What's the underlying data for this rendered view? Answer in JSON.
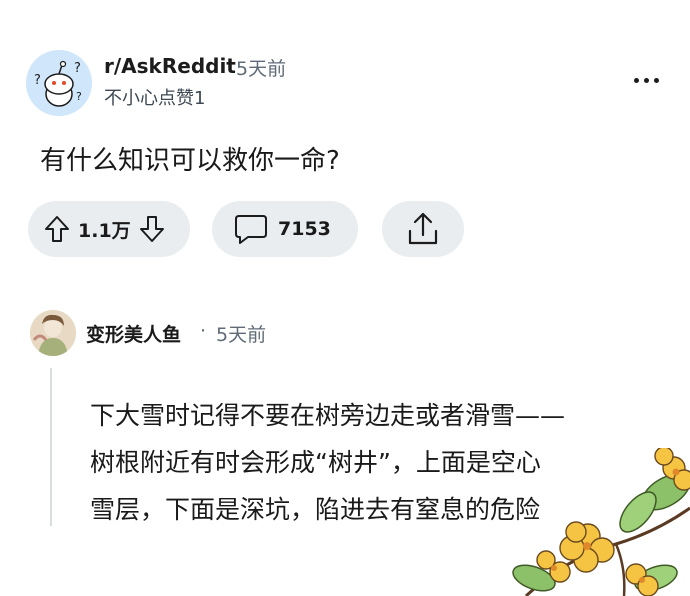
{
  "post": {
    "subreddit": "r/AskReddit",
    "time": "5天前",
    "user": "不小心点赞1",
    "title": "有什么知识可以救你一命?",
    "avatar_icon": "reddit-snoo-question-icon"
  },
  "actions": {
    "vote_count": "1.1万",
    "comment_count": "7153",
    "upvote_icon": "arrow-up-icon",
    "downvote_icon": "arrow-down-icon",
    "comment_icon": "speech-bubble-icon",
    "share_icon": "share-icon"
  },
  "comment": {
    "author": "变形美人鱼",
    "separator": "·",
    "time": "5天前",
    "lines": [
      "下大雪时记得不要在树旁边走或者滑雪——",
      "树根附近有时会形成“树井”，上面是空心",
      "雪层，下面是深坑，陷进去有窒息的危险"
    ]
  },
  "colors": {
    "pill_bg": "#eaedef",
    "muted_text": "#5f6b77",
    "avatar_bg": "#cfe6fb",
    "flower_petal": "#f6c443"
  }
}
